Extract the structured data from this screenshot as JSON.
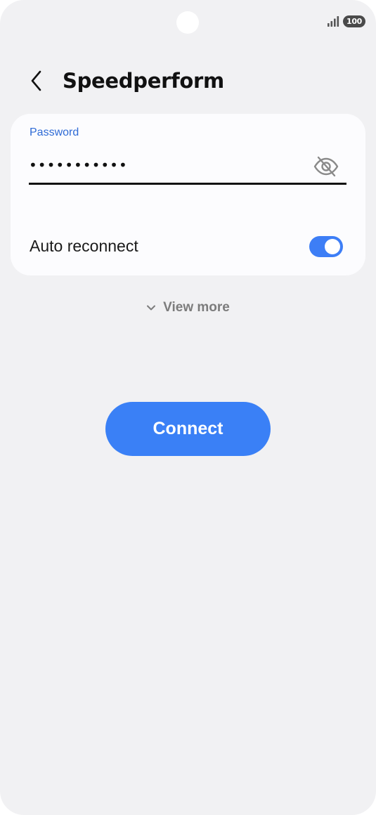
{
  "status_bar": {
    "battery_level": "100",
    "icons": [
      "camera-cutout",
      "signal-icon",
      "battery-icon"
    ]
  },
  "header": {
    "title": "Speedperform",
    "back_icon": "chevron-left-icon"
  },
  "password_field": {
    "label": "Password",
    "value": "•••••••••••",
    "visibility_icon": "eye-off-icon"
  },
  "auto_reconnect": {
    "label": "Auto reconnect",
    "enabled": true
  },
  "view_more": {
    "label": "View more",
    "icon": "chevron-down-icon"
  },
  "connect": {
    "label": "Connect"
  },
  "colors": {
    "background": "#f1f1f3",
    "card": "#fcfcfe",
    "accent": "#3a80f6",
    "label_blue": "#2f6bd6",
    "muted_text": "#7c7c7c"
  }
}
